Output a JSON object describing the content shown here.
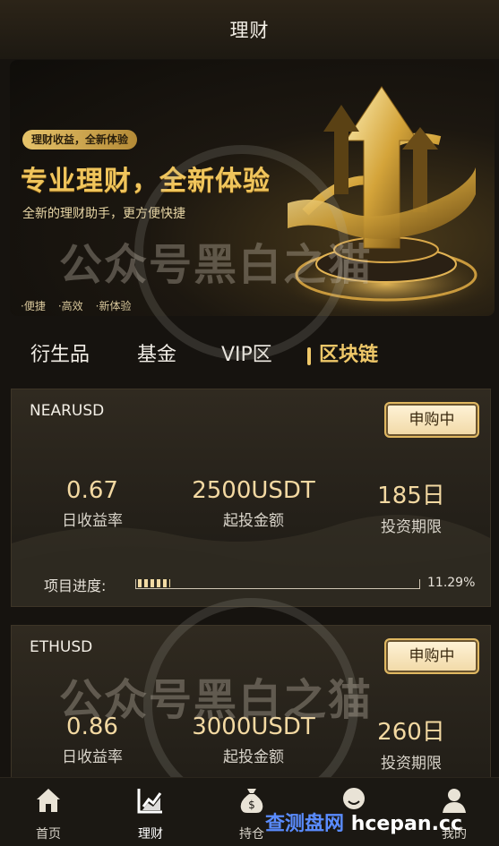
{
  "header": {
    "title": "理财"
  },
  "banner": {
    "pill": "理财收益，全新体验",
    "title": "专业理财，全新体验",
    "subtitle": "全新的理财助手，更方便快捷",
    "tags": [
      "·便捷",
      "·高效",
      "·新体验"
    ]
  },
  "tabs": [
    {
      "label": "衍生品",
      "active": false
    },
    {
      "label": "基金",
      "active": false
    },
    {
      "label": "VIP区",
      "active": false
    },
    {
      "label": "区块链",
      "active": true
    }
  ],
  "products": [
    {
      "name": "NEARUSD",
      "status": "申购中",
      "daily_rate": {
        "value": "0.67",
        "label": "日收益率"
      },
      "min_invest": {
        "value": "2500USDT",
        "label": "起投金额"
      },
      "term": {
        "value": "185日",
        "label": "投资期限"
      },
      "progress_label": "项目进度:",
      "progress_text": "11.29%",
      "progress": 0.1129
    },
    {
      "name": "ETHUSD",
      "status": "申购中",
      "daily_rate": {
        "value": "0.86",
        "label": "日收益率"
      },
      "min_invest": {
        "value": "3000USDT",
        "label": "起投金额"
      },
      "term": {
        "value": "260日",
        "label": "投资期限"
      }
    }
  ],
  "watermark": {
    "text": "公众号黑白之猫"
  },
  "bottom_nav": [
    {
      "label": "首页",
      "icon": "home-icon",
      "active": false
    },
    {
      "label": "理财",
      "icon": "chart-icon",
      "active": true
    },
    {
      "label": "持仓",
      "icon": "money-bag-icon",
      "active": false
    },
    {
      "label": "",
      "icon": "face-icon",
      "active": false
    },
    {
      "label": "我的",
      "icon": "user-icon",
      "active": false
    }
  ],
  "footer_watermark": {
    "prefix": "查测盘网",
    "domain": "hcepan.cc"
  },
  "colors": {
    "accent": "#efc869",
    "background": "#16130f",
    "card": "#2a251c"
  }
}
